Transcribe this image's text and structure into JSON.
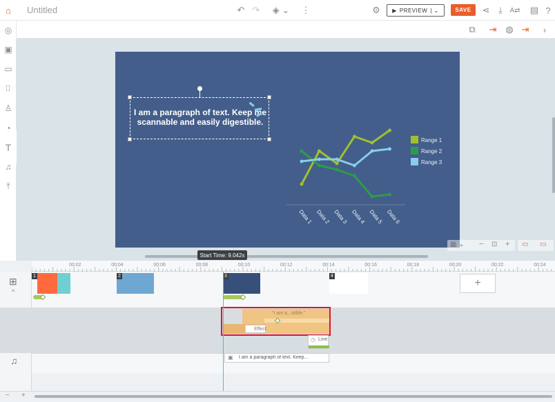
{
  "app": {
    "doc_title": "Untitled"
  },
  "toolbar": {
    "preview_label": "PREVIEW",
    "save_label": "SAVE"
  },
  "slide": {
    "text": "I am a paragraph of text. Keep me scannable and easily digestible."
  },
  "chart_data": {
    "type": "line",
    "categories": [
      "Data 1",
      "Data 2",
      "Data 3",
      "Data 4",
      "Data 5",
      "Data 6"
    ],
    "series": [
      {
        "name": "Range 1",
        "color": "#a0c12d",
        "values": [
          1.0,
          2.6,
          2.0,
          3.3,
          3.0,
          3.6
        ]
      },
      {
        "name": "Range 2",
        "color": "#2e9b4b",
        "values": [
          2.6,
          1.9,
          1.7,
          1.4,
          0.4,
          0.5
        ]
      },
      {
        "name": "Range 3",
        "color": "#89cdec",
        "values": [
          2.1,
          2.2,
          2.2,
          1.9,
          2.6,
          2.7
        ]
      }
    ],
    "ylim": [
      0,
      4
    ],
    "legend": "right"
  },
  "timeline": {
    "start_time": "Start Time: 9.042s",
    "ticks": [
      "00:02",
      "00:04",
      "00:06",
      "00:08",
      "00:10",
      "00:12",
      "00:14",
      "00:16",
      "00:18",
      "00:20",
      "00:22",
      "00:24"
    ],
    "scenes": [
      {
        "num": "1",
        "color": "#ff6a3d"
      },
      {
        "num": "2",
        "color": "#6fa7d3"
      },
      {
        "num": "3",
        "color": "#36507a"
      },
      {
        "num": "4",
        "color": "#ffffff"
      }
    ],
    "element_clip_label": "\"I am a...stible.\"",
    "effect_label": "Effect",
    "line_label": "Line",
    "audio_label": "I am a paragraph of text. Keep..."
  }
}
